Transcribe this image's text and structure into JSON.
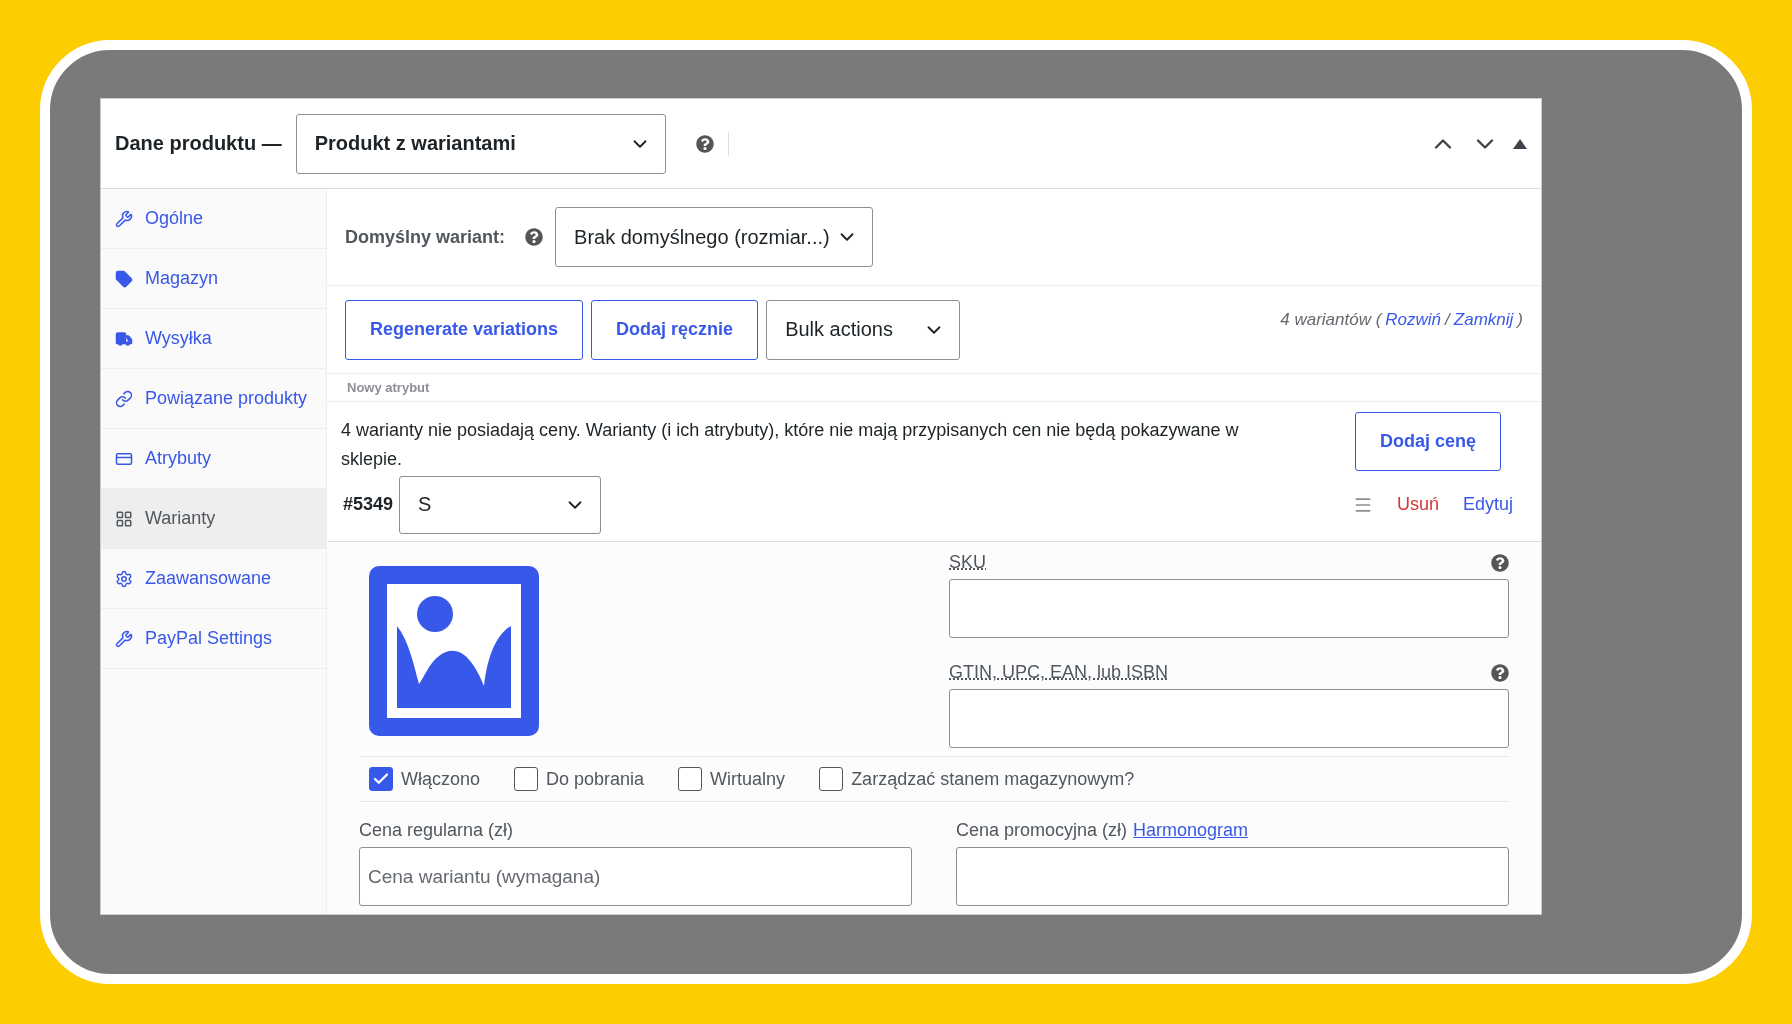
{
  "panel": {
    "title": "Dane produktu —",
    "product_type": "Produkt z wariantami"
  },
  "sidebar": {
    "items": [
      {
        "label": "Ogólne",
        "selected": false
      },
      {
        "label": "Magazyn",
        "selected": false
      },
      {
        "label": "Wysyłka",
        "selected": false
      },
      {
        "label": "Powiązane produkty",
        "selected": false
      },
      {
        "label": "Atrybuty",
        "selected": false
      },
      {
        "label": "Warianty",
        "selected": true
      },
      {
        "label": "Zaawansowane",
        "selected": false
      },
      {
        "label": "PayPal Settings",
        "selected": false
      }
    ]
  },
  "default_variant": {
    "label": "Domyślny wariant:",
    "value": "Brak domyślnego (rozmiar...)"
  },
  "toolbar": {
    "buttons": [
      "Regenerate variations",
      "Dodaj ręcznie"
    ],
    "bulk_actions": "Bulk actions",
    "count": "4 wariantów (",
    "expand_link": "Rozwiń",
    "separator": "/",
    "collapse_link": "Zamknij",
    "closing": ")"
  },
  "attribute_label": "Nowy atrybut",
  "notice": {
    "text": "4 warianty nie posiadają ceny. Warianty (i ich atrybuty), które nie mają przypisanych cen nie będą pokazywane w sklepie.",
    "button": "Dodaj cenę"
  },
  "variation": {
    "id": "#5349",
    "attribute_value": "S",
    "remove": "Usuń",
    "edit": "Edytuj",
    "sku_label": "SKU",
    "gtin_label": "GTIN, UPC, EAN, lub ISBN",
    "checkboxes": [
      {
        "label": "Włączono",
        "checked": true
      },
      {
        "label": "Do pobrania",
        "checked": false
      },
      {
        "label": "Wirtualny",
        "checked": false
      },
      {
        "label": "Zarządzać stanem magazynowym?",
        "checked": false
      }
    ],
    "regular_price": {
      "label": "Cena regularna (zł)",
      "placeholder": "Cena wariantu (wymagana)"
    },
    "sale_price": {
      "label": "Cena promocyjna (zł)",
      "link": "Harmonogram"
    }
  }
}
